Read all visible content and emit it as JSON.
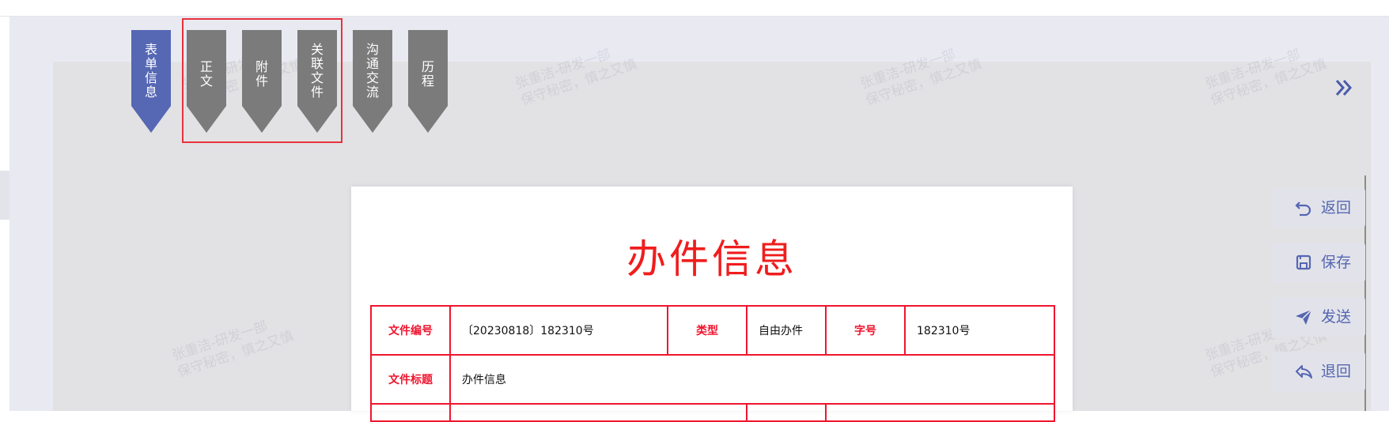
{
  "tabs": [
    {
      "label": "表\n单\n信\n息",
      "active": true
    },
    {
      "label": "正\n文",
      "active": false
    },
    {
      "label": "附\n件",
      "active": false
    },
    {
      "label": "关\n联\n文\n件",
      "active": false
    },
    {
      "label": "沟\n通\n交\n流",
      "active": false
    },
    {
      "label": "历\n程",
      "active": false
    }
  ],
  "collapse_icon": "double-chevron-right-icon",
  "document": {
    "title": "办件信息",
    "rows": {
      "file_no_label": "文件编号",
      "file_no_value": "〔20230818〕182310号",
      "type_label": "类型",
      "type_value": "自由办件",
      "word_no_label": "字号",
      "word_no_value": "182310号",
      "file_title_label": "文件标题",
      "file_title_value": "办件信息"
    }
  },
  "actions": [
    {
      "label": "返回",
      "icon": "undo-icon"
    },
    {
      "label": "保存",
      "icon": "save-icon"
    },
    {
      "label": "发送",
      "icon": "send-icon"
    },
    {
      "label": "退回",
      "icon": "reply-icon"
    }
  ],
  "watermark": {
    "line1": "张重洁-研发一部",
    "line2": "保守秘密，慎之又慎"
  },
  "colors": {
    "accent": "#5668b4",
    "tab_gray": "#7b7b7b",
    "red": "#f01d1d",
    "action_text": "#5566b1"
  }
}
